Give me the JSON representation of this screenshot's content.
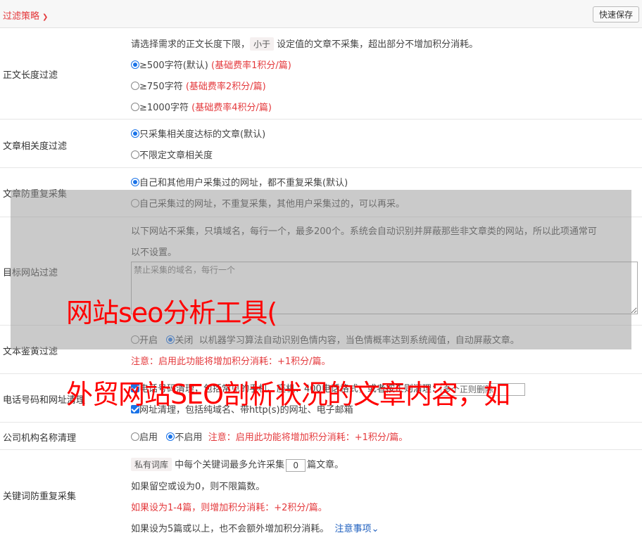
{
  "header": {
    "title": "过滤策略",
    "save_label": "快速保存"
  },
  "length_filter": {
    "label": "正文长度过滤",
    "desc_pre": "请选择需求的正文长度下限，",
    "desc_tag": "小于",
    "desc_post": "设定值的文章不采集，超出部分不增加积分消耗。",
    "options": [
      {
        "text": "≥500字符(默认)",
        "note": "(基础费率1积分/篇)",
        "checked": true
      },
      {
        "text": "≥750字符",
        "note": "(基础费率2积分/篇)",
        "checked": false
      },
      {
        "text": "≥1000字符",
        "note": "(基础费率4积分/篇)",
        "checked": false
      }
    ]
  },
  "relevance": {
    "label": "文章相关度过滤",
    "options": [
      {
        "text": "只采集相关度达标的文章(默认)",
        "checked": true
      },
      {
        "text": "不限定文章相关度",
        "checked": false
      }
    ]
  },
  "dedupe": {
    "label": "文章防重复采集",
    "options": [
      {
        "text": "自己和其他用户采集过的网址，都不重复采集(默认)",
        "checked": true
      },
      {
        "text": "自己采集过的网址，不重复采集，其他用户采集过的，可以再采。",
        "checked": false
      }
    ]
  },
  "site_filter": {
    "label": "目标网站过滤",
    "desc_1": "以下网站不采集，只填域名，每行一个，最多200个。系统会自动识别并屏蔽那些非文章类的网站，所以此项通常可",
    "desc_2": "以不设置。",
    "placeholder": "禁止采集的域名，每行一个"
  },
  "porn_filter": {
    "label": "文本鉴黄过滤",
    "on_label": "开启",
    "off_label": "关闭",
    "desc": "以机器学习算法自动识别色情内容，当色情概率达到系统阈值，自动屏蔽文章。",
    "note": "注意：启用此功能将增加积分消耗：+1积分/篇。"
  },
  "phone_filter": {
    "label": "电话号码和网址清理",
    "line1": "电话号码清理，包括常见的手机、座机、400电话格式，或者按正则清理：",
    "input_value": "多个正则删除",
    "line2": "网址清理，包括纯域名、带http(s)的网址、电子邮箱"
  },
  "org_filter": {
    "label": "公司机构名称清理",
    "on_label": "启用",
    "off_label": "不启用",
    "note": "注意：启用此功能将增加积分消耗：+1积分/篇。"
  },
  "keyword_dedupe": {
    "label": "关键词防重复采集",
    "tag": "私有词库",
    "line1_pre": "中每个关键词最多允许采集",
    "value": "0",
    "line1_post": "篇文章。",
    "line2": "如果留空或设为0，则不限篇数。",
    "line3": "如果设为1-4篇，则增加积分消耗：+2积分/篇。",
    "line4": "如果设为5篇或以上，也不会额外增加积分消耗。",
    "link": "注意事项"
  },
  "watermark": {
    "line1": "网站seo分析工具(",
    "line2": "外贸网站SEO剖析状况的文章内容，如"
  }
}
